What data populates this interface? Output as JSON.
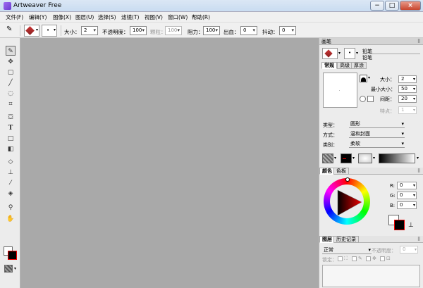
{
  "window": {
    "title": "Artweaver Free",
    "min": "−",
    "max": "□",
    "close": "×"
  },
  "menu": [
    "文件(F)",
    "编辑(Y)",
    "图像(X)",
    "图层(U)",
    "选择(S)",
    "滤镜(T)",
    "视图(V)",
    "窗口(W)",
    "帮助(R)"
  ],
  "toolbar": {
    "size_label": "大小：",
    "size_value": "2",
    "opacity_label": "不透明度：",
    "opacity_value": "100",
    "hardness_label": "颗粒：",
    "hardness_value": "100",
    "resist_label": "阻力：",
    "resist_value": "100",
    "bleed_label": "出血：",
    "bleed_value": "0",
    "jitter_label": "抖动：",
    "jitter_value": "0"
  },
  "tools": [
    "pencil-tool",
    "move-tool",
    "rect-select-tool",
    "brush-tool",
    "lasso-tool",
    "crop-tool",
    "stamp-tool",
    "text-tool",
    "shape-tool",
    "gradient-tool",
    "eraser-tool",
    "clone-tool",
    "eyedropper-tool",
    "fill-tool",
    "zoom-tool",
    "hand-tool"
  ],
  "brush_panel": {
    "title": "画笔",
    "category": "铅笔",
    "variant": "铅笔",
    "tabs": [
      "常规",
      "高级",
      "厚涂"
    ],
    "size_label": "大小：",
    "size_value": "2",
    "min_size_label": "最小大小：",
    "min_size_value": "50",
    "spacing_label": "间距：",
    "spacing_value": "20",
    "points_label": "特点：",
    "points_value": "1",
    "type_label": "类型：",
    "type_value": "圆形",
    "method_label": "方式：",
    "method_value": "温和封面",
    "category_label": "类别：",
    "category_value": "柔软"
  },
  "color_panel": {
    "tabs": [
      "颜色",
      "色板"
    ],
    "r_label": "R:",
    "r_value": "0",
    "g_label": "G:",
    "g_value": "0",
    "b_label": "B:",
    "b_value": "0",
    "primary_color": "#000000",
    "accent_red": "#e00000"
  },
  "layers_panel": {
    "tabs": [
      "图层",
      "历史记录"
    ],
    "blend_value": "正常",
    "opacity_label": "不透明度：",
    "opacity_value": "0",
    "lock_label": "锁定："
  }
}
